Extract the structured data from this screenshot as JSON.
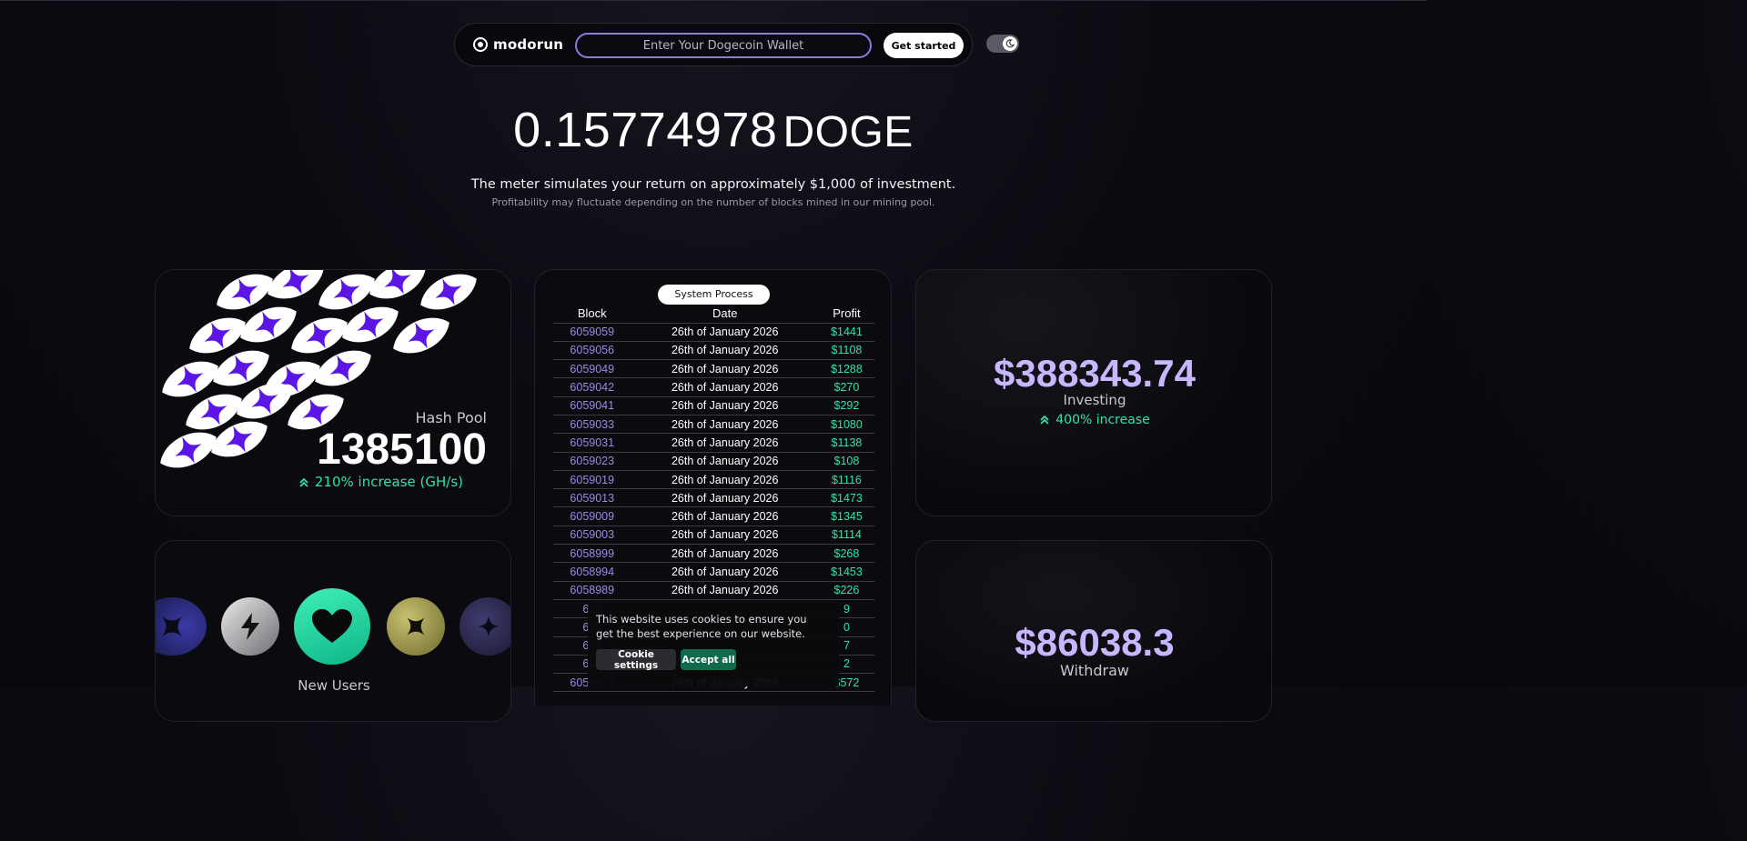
{
  "nav": {
    "brand": "modorun",
    "wallet_placeholder": "Enter Your Dogecoin Wallet",
    "cta_label": "Get started",
    "theme_toggle_icon": "moon-icon"
  },
  "hero": {
    "amount": "0.15774978",
    "unit": "DOGE",
    "subtitle": "The meter simulates your return on approximately $1,000 of investment.",
    "note": "Profitability may fluctuate depending on the number of blocks mined in our mining pool."
  },
  "hash_pool": {
    "label": "Hash Pool",
    "value": "1385100",
    "increase": "210% increase (GH/s)"
  },
  "system_process": {
    "title": "System Process",
    "columns": [
      "Block",
      "Date",
      "Profit"
    ],
    "rows": [
      {
        "block": "6059059",
        "date": "26th of January 2026",
        "profit": "$1441"
      },
      {
        "block": "6059056",
        "date": "26th of January 2026",
        "profit": "$1108"
      },
      {
        "block": "6059049",
        "date": "26th of January 2026",
        "profit": "$1288"
      },
      {
        "block": "6059042",
        "date": "26th of January 2026",
        "profit": "$270"
      },
      {
        "block": "6059041",
        "date": "26th of January 2026",
        "profit": "$292"
      },
      {
        "block": "6059033",
        "date": "26th of January 2026",
        "profit": "$1080"
      },
      {
        "block": "6059031",
        "date": "26th of January 2026",
        "profit": "$1138"
      },
      {
        "block": "6059023",
        "date": "26th of January 2026",
        "profit": "$108"
      },
      {
        "block": "6059019",
        "date": "26th of January 2026",
        "profit": "$1116"
      },
      {
        "block": "6059013",
        "date": "26th of January 2026",
        "profit": "$1473"
      },
      {
        "block": "6059009",
        "date": "26th of January 2026",
        "profit": "$1345"
      },
      {
        "block": "6059003",
        "date": "26th of January 2026",
        "profit": "$1114"
      },
      {
        "block": "6058999",
        "date": "26th of January 2026",
        "profit": "$268"
      },
      {
        "block": "6058994",
        "date": "26th of January 2026",
        "profit": "$1453"
      },
      {
        "block": "6058989",
        "date": "26th of January 2026",
        "profit": "$226"
      },
      {
        "block": "605",
        "date": "",
        "profit": "9"
      },
      {
        "block": "605",
        "date": "",
        "profit": "0"
      },
      {
        "block": "605",
        "date": "",
        "profit": "7"
      },
      {
        "block": "605",
        "date": "",
        "profit": "2"
      },
      {
        "block": "6058966",
        "date": "26th of January 2026",
        "profit": "$572"
      }
    ]
  },
  "investing": {
    "value": "$388343.74",
    "label": "Investing",
    "increase": "400% increase"
  },
  "new_users": {
    "label": "New Users"
  },
  "withdraw": {
    "value": "$86038.3",
    "label": "Withdraw"
  },
  "cookie": {
    "text": "This website uses cookies to ensure you get the best experience on our website.",
    "settings_label": "Cookie settings",
    "accept_label": "Accept all"
  },
  "colors": {
    "accent_purple": "#8b7ae0",
    "money_purple": "#c8b7ff",
    "success_green": "#2fe3a6",
    "pattern_violet": "#5b16e6"
  }
}
